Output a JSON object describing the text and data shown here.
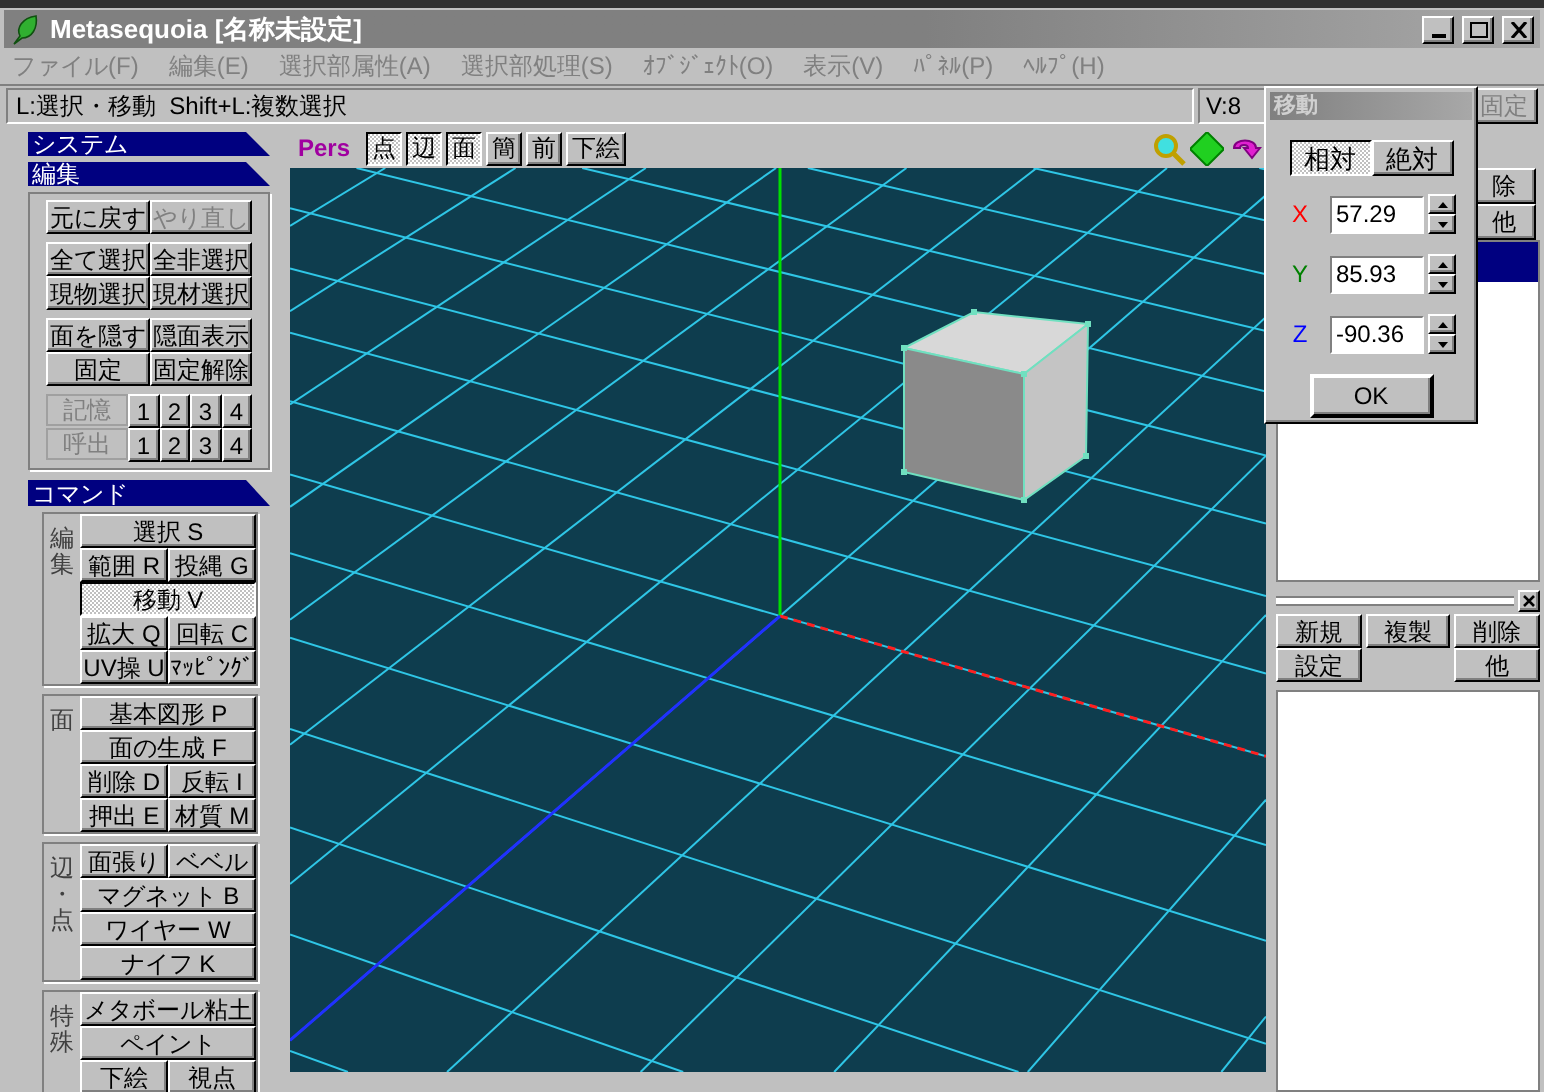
{
  "window": {
    "title": "Metasequoia [名称未設定]"
  },
  "menu": [
    "ファイル(F)",
    "編集(E)",
    "選択部属性(A)",
    "選択部処理(S)",
    "ｵﾌﾞｼﾞｪｸﾄ(O)",
    "表示(V)",
    "ﾊﾟﾈﾙ(P)",
    "ﾍﾙﾌﾟ(H)"
  ],
  "status": {
    "hint": "L:選択・移動  Shift+L:複数選択",
    "vertex_count": "V:8",
    "lock_button": "固定"
  },
  "left_panel": {
    "system_header": "システム",
    "edit": {
      "header": "編集",
      "groups": [
        [
          [
            {
              "label": "元に戻す",
              "disabled": false
            },
            {
              "label": "やり直し",
              "disabled": true
            }
          ]
        ],
        [
          [
            {
              "label": "全て選択",
              "disabled": false
            },
            {
              "label": "全非選択",
              "disabled": false
            }
          ],
          [
            {
              "label": "現物選択",
              "disabled": false
            },
            {
              "label": "現材選択",
              "disabled": false
            }
          ]
        ],
        [
          [
            {
              "label": "面を隠す",
              "disabled": false
            },
            {
              "label": "隠面表示",
              "disabled": false
            }
          ],
          [
            {
              "label": "固定",
              "disabled": false
            },
            {
              "label": "固定解除",
              "disabled": false
            }
          ]
        ]
      ],
      "memory": [
        {
          "label": "記憶",
          "slots": [
            "1",
            "2",
            "3",
            "4"
          ]
        },
        {
          "label": "呼出",
          "slots": [
            "1",
            "2",
            "3",
            "4"
          ]
        }
      ]
    },
    "commands": {
      "header": "コマンド",
      "groups": [
        {
          "label": "編集",
          "rows": [
            [
              {
                "label": "選択 S",
                "selected": false
              }
            ],
            [
              {
                "label": "範囲 R",
                "selected": false
              },
              {
                "label": "投縄 G",
                "selected": false
              }
            ],
            [
              {
                "label": "移動 V",
                "selected": true
              }
            ],
            [
              {
                "label": "拡大 Q",
                "selected": false
              },
              {
                "label": "回転 C",
                "selected": false
              }
            ],
            [
              {
                "label": "UV操 U",
                "selected": false
              },
              {
                "label": "ﾏｯﾋﾟﾝｸﾞ",
                "selected": false
              }
            ]
          ]
        },
        {
          "label": "面",
          "rows": [
            [
              {
                "label": "基本図形 P",
                "selected": false
              }
            ],
            [
              {
                "label": "面の生成 F",
                "selected": false
              }
            ],
            [
              {
                "label": "削除 D",
                "selected": false
              },
              {
                "label": "反転 I",
                "selected": false
              }
            ],
            [
              {
                "label": "押出 E",
                "selected": false
              },
              {
                "label": "材質 M",
                "selected": false
              }
            ]
          ]
        },
        {
          "label": "辺・点",
          "rows": [
            [
              {
                "label": "面張り",
                "selected": false
              },
              {
                "label": "ベベル",
                "selected": false
              }
            ],
            [
              {
                "label": "マグネット B",
                "selected": false
              }
            ],
            [
              {
                "label": "ワイヤー W",
                "selected": false
              }
            ],
            [
              {
                "label": "ナイフ K",
                "selected": false
              }
            ]
          ]
        },
        {
          "label": "特殊",
          "rows": [
            [
              {
                "label": "メタボール粘土",
                "selected": false
              }
            ],
            [
              {
                "label": "ペイント",
                "selected": false
              }
            ],
            [
              {
                "label": "下絵",
                "selected": false
              },
              {
                "label": "視点",
                "selected": false
              }
            ]
          ]
        }
      ]
    }
  },
  "viewport": {
    "projection": "Pers",
    "view_buttons": [
      {
        "label": "点",
        "selected": true
      },
      {
        "label": "辺",
        "selected": true
      },
      {
        "label": "面",
        "selected": true
      },
      {
        "label": "簡",
        "selected": false
      },
      {
        "label": "前",
        "selected": false
      },
      {
        "label": "下絵",
        "selected": false
      }
    ]
  },
  "object_panel": {
    "buttons": [
      "除",
      "他"
    ],
    "objects": [
      {
        "selected": true
      }
    ]
  },
  "material_panel": {
    "rows": [
      [
        "新規",
        "複製",
        "削除"
      ],
      [
        "設定",
        "",
        "他"
      ]
    ]
  },
  "move_dialog": {
    "title": "移動",
    "modes": [
      {
        "label": "相対",
        "selected": true
      },
      {
        "label": "絶対",
        "selected": false
      }
    ],
    "fields": [
      {
        "axis": "X",
        "value": "57.29",
        "color": "#ff0000"
      },
      {
        "axis": "Y",
        "value": "85.93",
        "color": "#008000"
      },
      {
        "axis": "Z",
        "value": "-90.36",
        "color": "#0000ff"
      }
    ],
    "ok": "OK"
  }
}
